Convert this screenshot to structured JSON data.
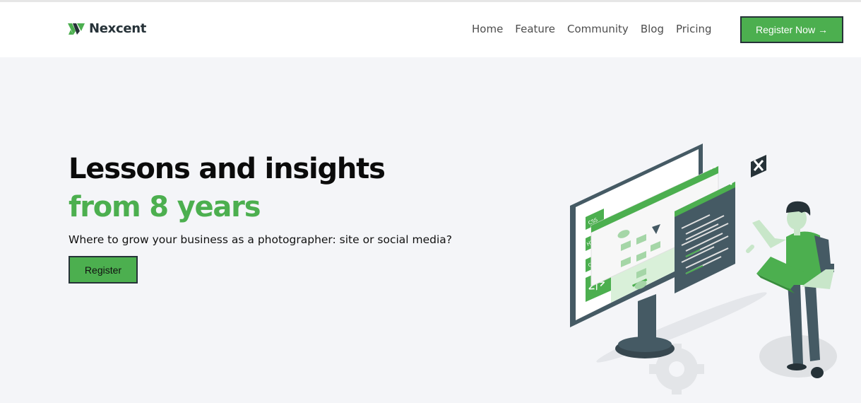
{
  "header": {
    "brand": "Nexcent",
    "logo_icon": "nexcent-logo-icon",
    "nav": [
      "Home",
      "Feature",
      "Community",
      "Blog",
      "Pricing"
    ],
    "cta_label": "Register Now →"
  },
  "hero": {
    "title_line1": "Lessons and insights",
    "title_line2": "from 8 years",
    "subtitle": "Where to grow your business as a photographer: site or social media?",
    "button_label": "Register",
    "illustration": "developer-with-laptop-and-monitor-illustration",
    "code_tags": [
      "CSS",
      "HTML",
      "C++"
    ]
  },
  "colors": {
    "accent": "#4caf4f",
    "dark": "#263238",
    "hero_bg": "#f4f5f8"
  }
}
